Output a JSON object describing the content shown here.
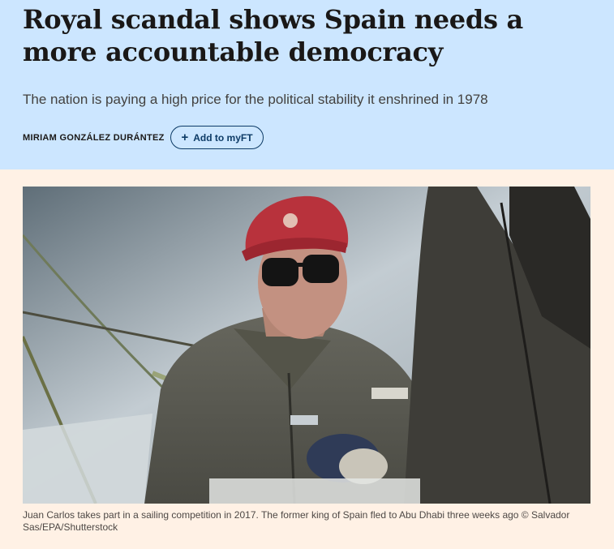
{
  "article": {
    "headline": "Royal scandal shows Spain needs a more accountable democracy",
    "standfirst": "The nation is paying a high price for the political stability it enshrined in 1978",
    "byline": "MIRIAM GONZÁLEZ DURÁNTEZ",
    "myft_button": {
      "icon": "plus-icon",
      "plus": "+",
      "label": "Add to myFT"
    }
  },
  "image": {
    "caption": "Juan Carlos takes part in a sailing competition in 2017. The former king of Spain fled to Abu Dhabi three weeks ago © Salvador Sas/EPA/Shutterstock"
  },
  "colors": {
    "header_background": "#cce6ff",
    "page_background": "#fff1e5",
    "button_accent": "#0d3b66"
  }
}
